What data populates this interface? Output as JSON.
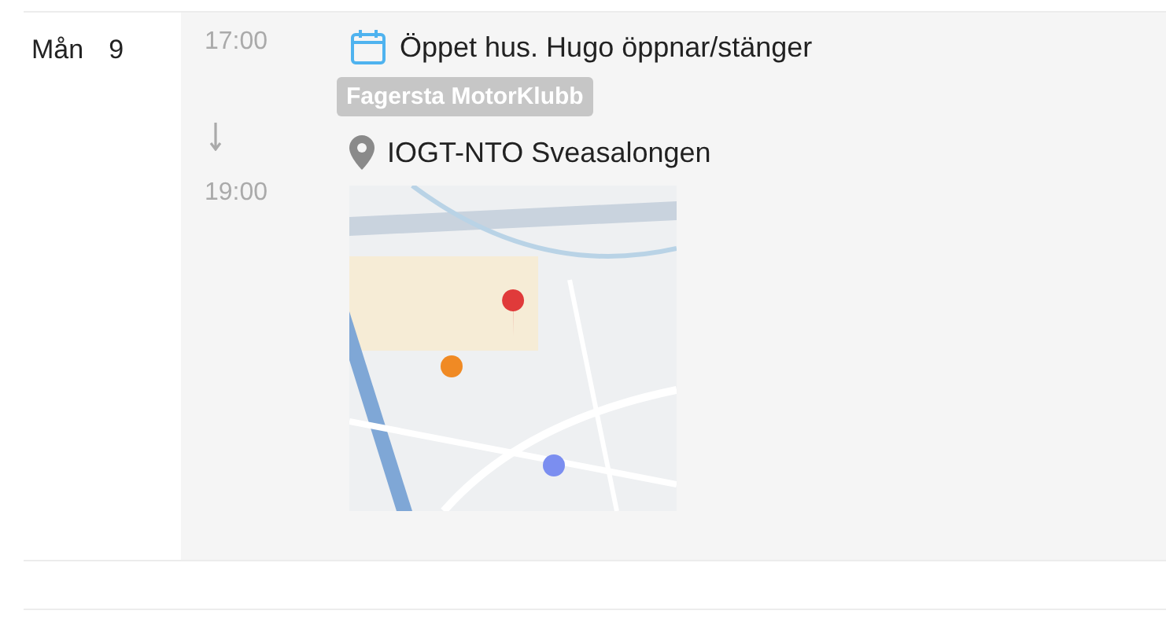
{
  "day": {
    "weekday": "Mån",
    "date": "9"
  },
  "events": [
    {
      "start": "17:00",
      "end": "19:00",
      "title": "Öppet hus. Hugo öppnar/stänger",
      "organizer": "Fagersta MotorKlubb",
      "location": "IOGT-NTO Sveasalongen"
    }
  ]
}
